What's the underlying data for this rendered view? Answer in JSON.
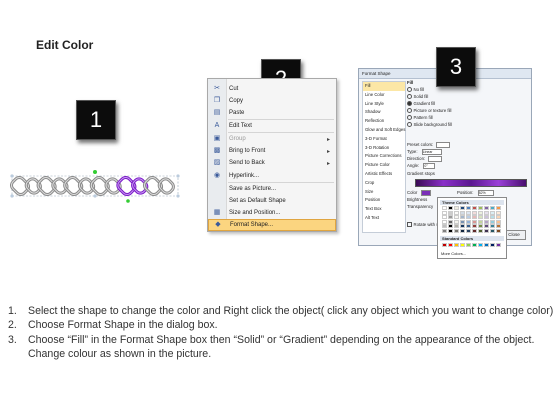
{
  "title": "Edit Color",
  "badges": [
    "1",
    "2",
    "3"
  ],
  "context_menu": {
    "items": [
      {
        "label": "Cut",
        "icon": "scissors-icon",
        "glyph": "✂",
        "disabled": false,
        "submenu": false
      },
      {
        "label": "Copy",
        "icon": "copy-icon",
        "glyph": "❐",
        "disabled": false,
        "submenu": false
      },
      {
        "label": "Paste",
        "icon": "paste-icon",
        "glyph": "▤",
        "disabled": false,
        "submenu": false
      },
      {
        "label": "Edit Text",
        "icon": "edit-text-icon",
        "glyph": "A",
        "disabled": false,
        "submenu": false
      },
      {
        "label": "Group",
        "icon": "group-icon",
        "glyph": "▣",
        "disabled": true,
        "submenu": true
      },
      {
        "label": "Bring to Front",
        "icon": "bring-front-icon",
        "glyph": "▩",
        "disabled": false,
        "submenu": true
      },
      {
        "label": "Send to Back",
        "icon": "send-back-icon",
        "glyph": "▨",
        "disabled": false,
        "submenu": true
      },
      {
        "label": "Hyperlink...",
        "icon": "hyperlink-icon",
        "glyph": "◉",
        "disabled": false,
        "submenu": false
      },
      {
        "label": "Save as Picture...",
        "icon": "",
        "glyph": "",
        "disabled": false,
        "submenu": false
      },
      {
        "label": "Set as Default Shape",
        "icon": "",
        "glyph": "",
        "disabled": false,
        "submenu": false
      },
      {
        "label": "Size and Position...",
        "icon": "size-position-icon",
        "glyph": "▦",
        "disabled": false,
        "submenu": false
      },
      {
        "label": "Format Shape...",
        "icon": "format-shape-icon",
        "glyph": "◆",
        "disabled": false,
        "submenu": false,
        "highlighted": true
      }
    ]
  },
  "format_dialog": {
    "title": "Format Shape",
    "categories": [
      "Fill",
      "Line Color",
      "Line Style",
      "Shadow",
      "Reflection",
      "Glow and Soft Edges",
      "3-D Format",
      "3-D Rotation",
      "Picture Corrections",
      "Picture Color",
      "Artistic Effects",
      "Crop",
      "Size",
      "Position",
      "Text Box",
      "Alt Text"
    ],
    "section": "Fill",
    "options": [
      "No fill",
      "Solid fill",
      "Gradient fill",
      "Picture or texture fill",
      "Pattern fill",
      "Slide background fill"
    ],
    "selected_option": "Gradient fill",
    "fields": {
      "preset_colors": "Preset colors:",
      "type_label": "Type:",
      "type_value": "Linear",
      "direction_label": "Direction:",
      "angle_label": "Angle:",
      "angle_value": "0°",
      "gradient_stops": "Gradient stops",
      "color_label": "Color",
      "position_label": "Position:",
      "position_value": "52%",
      "brightness_label": "Brightness",
      "transparency_label": "Transparency",
      "rotate_label": "Rotate with shape"
    },
    "close_label": "Close"
  },
  "palette": {
    "theme_header": "Theme Colors",
    "standard_header": "Standard Colors",
    "more_label": "More Colors...",
    "theme_top": [
      "#ffffff",
      "#000000",
      "#eeece1",
      "#1f497d",
      "#4f81bd",
      "#c0504d",
      "#9bbb59",
      "#8064a2",
      "#4bacc6",
      "#f79646"
    ],
    "standard": [
      "#c00000",
      "#ff0000",
      "#ffc000",
      "#ffff00",
      "#92d050",
      "#00b050",
      "#00b0f0",
      "#0070c0",
      "#002060",
      "#7030a0"
    ]
  },
  "instructions": [
    {
      "num": "1.",
      "text": "Select the shape to change the color and Right click the object( click any object which you want to change color)"
    },
    {
      "num": "2.",
      "text": "Choose Format Shape in the dialog box."
    },
    {
      "num": "3.",
      "text": "Choose “Fill” in the Format Shape box then “Solid” or “Gradient” depending on the appearance of the object. Change colour as shown in the picture."
    }
  ]
}
